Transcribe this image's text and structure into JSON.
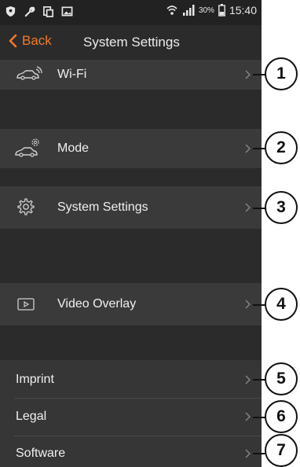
{
  "status_bar": {
    "battery_percent": "30%",
    "time": "15:40",
    "left_icons": [
      "shield-icon",
      "wrench-icon",
      "copy-icon",
      "image-icon"
    ],
    "right_icons": [
      "wifi-icon",
      "signal-icon",
      "battery-icon"
    ]
  },
  "nav": {
    "back_label": "Back",
    "title": "System Settings"
  },
  "items": [
    {
      "label": "Wi-Fi",
      "icon": "car-wifi-icon"
    },
    {
      "label": "Mode",
      "icon": "car-gear-icon"
    },
    {
      "label": "System Settings",
      "icon": "gear-icon"
    },
    {
      "label": "Video Overlay",
      "icon": "video-overlay-icon"
    },
    {
      "label": "Imprint"
    },
    {
      "label": "Legal"
    },
    {
      "label": "Software"
    }
  ],
  "callouts": [
    "1",
    "2",
    "3",
    "4",
    "5",
    "6",
    "7"
  ],
  "colors": {
    "accent": "#f07a2a",
    "background": "#2b2b2b",
    "row": "#3a3a3a"
  }
}
